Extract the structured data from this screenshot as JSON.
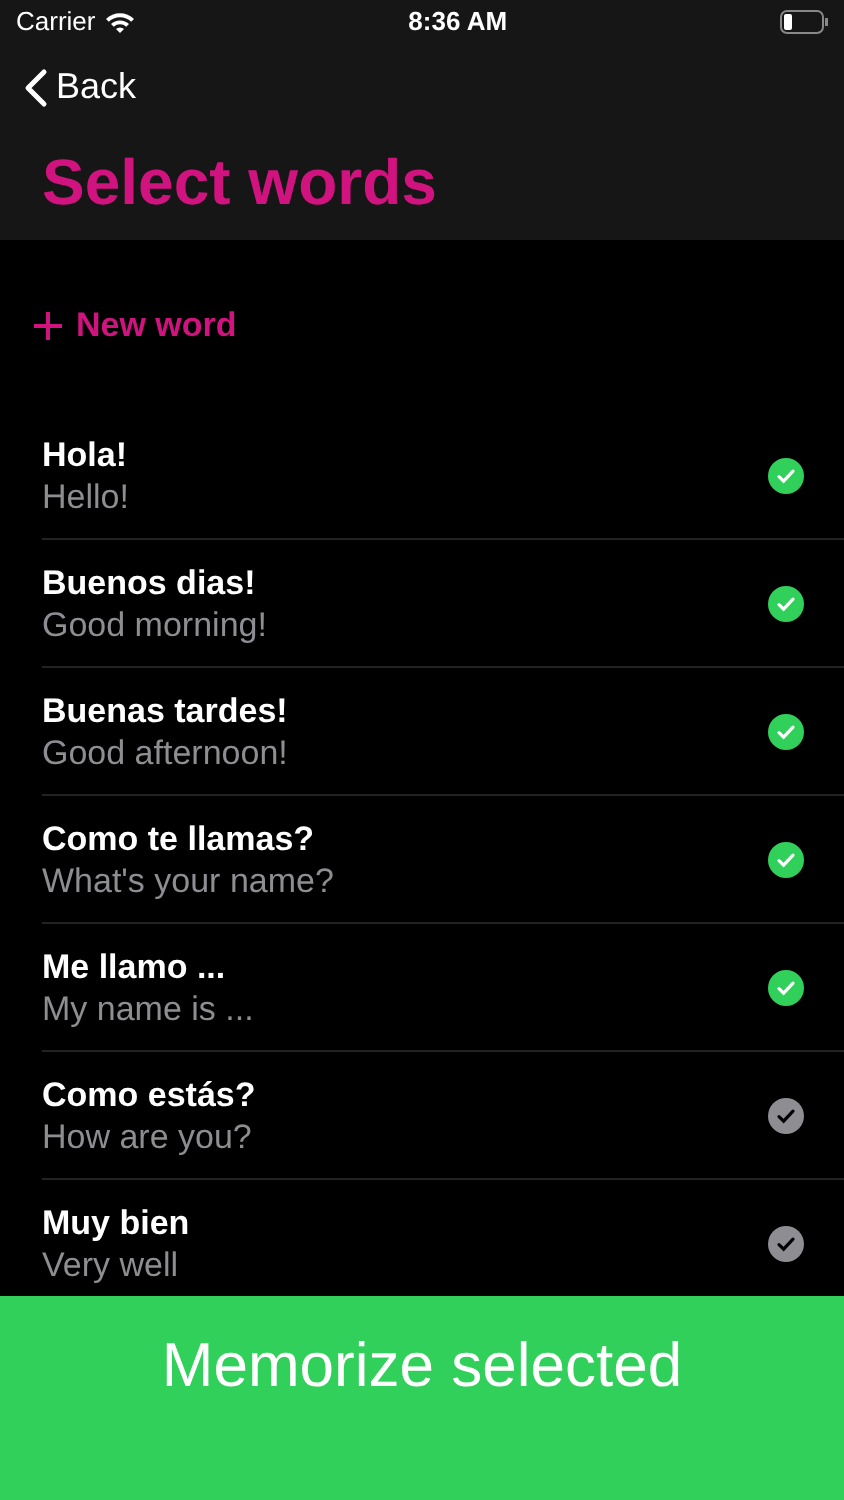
{
  "status_bar": {
    "carrier": "Carrier",
    "time": "8:36 AM"
  },
  "nav": {
    "back": "Back",
    "title": "Select words"
  },
  "new_word": {
    "label": "New word"
  },
  "words": [
    {
      "word": "Hola!",
      "translation": "Hello!",
      "selected": true
    },
    {
      "word": "Buenos dias!",
      "translation": "Good morning!",
      "selected": true
    },
    {
      "word": "Buenas tardes!",
      "translation": "Good afternoon!",
      "selected": true
    },
    {
      "word": "Como te llamas?",
      "translation": "What's your name?",
      "selected": true
    },
    {
      "word": "Me llamo ...",
      "translation": "My name is ...",
      "selected": true
    },
    {
      "word": "Como estás?",
      "translation": "How are you?",
      "selected": false
    },
    {
      "word": "Muy bien",
      "translation": "Very well",
      "selected": false
    }
  ],
  "action_button": {
    "label": "Memorize selected"
  }
}
